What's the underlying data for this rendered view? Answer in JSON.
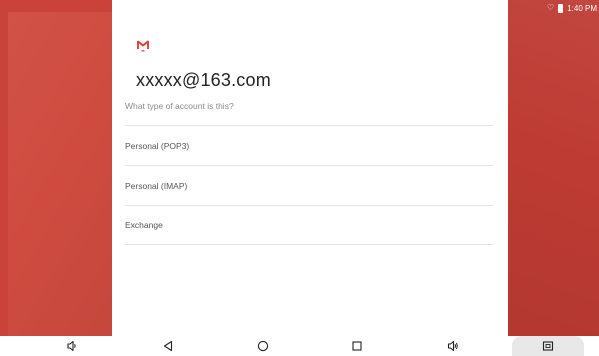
{
  "status_bar": {
    "time": "1:40 PM"
  },
  "setup": {
    "email": "xxxxx@163.com",
    "question": "What type of account is this?",
    "options": [
      {
        "label": "Personal (POP3)"
      },
      {
        "label": "Personal (IMAP)"
      },
      {
        "label": "Exchange"
      }
    ]
  },
  "colors": {
    "accent": "#c9433a",
    "logo_red": "#d93a2f"
  },
  "nav_bar": {
    "icons": [
      "volume-down-icon",
      "back-icon",
      "home-icon",
      "recents-icon",
      "volume-up-icon",
      "screenshot-icon"
    ]
  }
}
